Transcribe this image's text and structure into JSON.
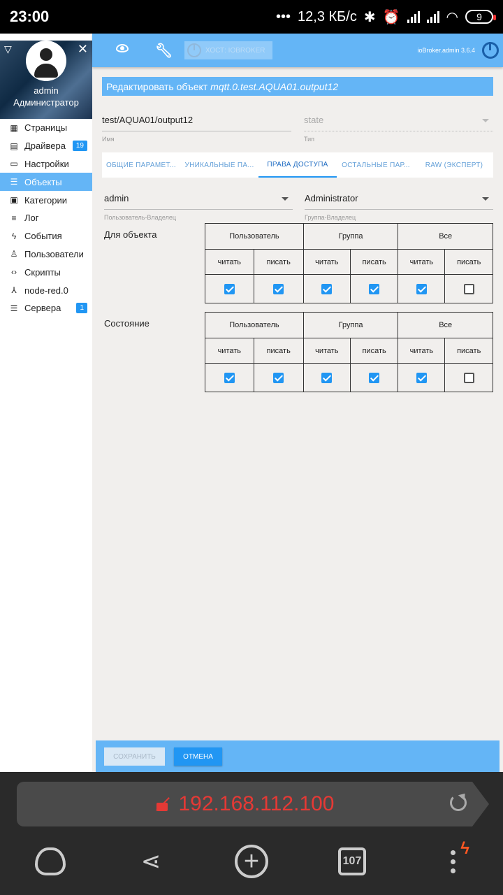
{
  "statusbar": {
    "time": "23:00",
    "dots": "•••",
    "speed": "12,3 КБ/с",
    "battery": "9"
  },
  "sidebar": {
    "user_name": "admin",
    "user_role": "Администратор",
    "items": [
      {
        "label": "Страницы",
        "icon": "grid-icon"
      },
      {
        "label": "Драйвера",
        "icon": "store-icon",
        "badge": "19"
      },
      {
        "label": "Настройки",
        "icon": "settings-icon"
      },
      {
        "label": "Объекты",
        "icon": "list-icon"
      },
      {
        "label": "Категории",
        "icon": "category-icon"
      },
      {
        "label": "Лог",
        "icon": "log-icon"
      },
      {
        "label": "События",
        "icon": "bolt-icon"
      },
      {
        "label": "Пользователи",
        "icon": "user-icon"
      },
      {
        "label": "Скрипты",
        "icon": "code-icon"
      },
      {
        "label": "node-red.0",
        "icon": "node-red-icon"
      },
      {
        "label": "Сервера",
        "icon": "servers-icon",
        "badge": "1"
      }
    ]
  },
  "topbar": {
    "host_label": "ХОСТ: IOBROKER",
    "version": "ioBroker.admin 3.6.4"
  },
  "editor": {
    "title_prefix": "Редактировать объект",
    "object_id": "mqtt.0.test.AQUA01.output12",
    "name_value": "test/AQUA01/output12",
    "name_label": "Имя",
    "type_value": "state",
    "type_label": "Тип",
    "tabs": [
      {
        "label": "ОБЩИЕ ПАРАМЕТ..."
      },
      {
        "label": "УНИКАЛЬНЫЕ ПА..."
      },
      {
        "label": "ПРАВА ДОСТУПА"
      },
      {
        "label": "ОСТАЛЬНЫЕ ПАР..."
      },
      {
        "label": "RAW (ЭКСПЕРТ)"
      }
    ],
    "owner_value": "admin",
    "owner_label": "Пользователь-Владелец",
    "group_value": "Administrator",
    "group_label": "Группа-Владелец",
    "sections": [
      {
        "label": "Для объекта",
        "checks": [
          true,
          true,
          true,
          true,
          true,
          false
        ]
      },
      {
        "label": "Состояние",
        "checks": [
          true,
          true,
          true,
          true,
          true,
          false
        ]
      }
    ],
    "col_user": "Пользователь",
    "col_group": "Группа",
    "col_all": "Все",
    "read": "читать",
    "write": "писать"
  },
  "footer": {
    "save": "СОХРАНИТЬ",
    "cancel": "ОТМЕНА"
  },
  "browser": {
    "url": "192.168.112.100",
    "tabs_count": "107"
  },
  "colors": {
    "accent": "#64b5f6",
    "primary": "#2196f3",
    "url_insecure": "#e53935"
  }
}
